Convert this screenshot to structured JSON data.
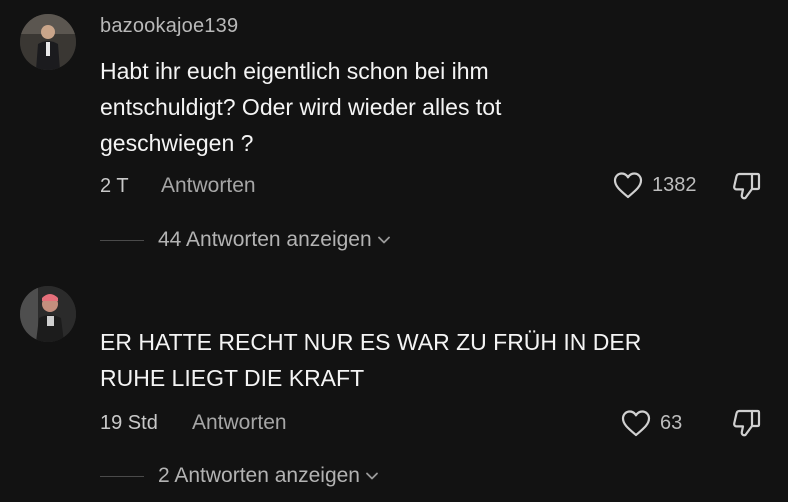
{
  "comments": [
    {
      "username": "bazookajoe139",
      "text_lines": [
        "Habt ihr euch eigentlich schon bei ihm",
        "entschuldigt? Oder wird wieder alles tot",
        "geschwiegen ?"
      ],
      "time": "2 T",
      "reply_label": "Antworten",
      "likes": "1382",
      "view_replies": "44 Antworten anzeigen"
    },
    {
      "username": "",
      "text_lines": [
        "ER HATTE RECHT NUR ES WAR ZU FRÜH IN DER",
        "RUHE LIEGT DIE KRAFT"
      ],
      "time": "19 Std",
      "reply_label": "Antworten",
      "likes": "63",
      "view_replies": "2 Antworten anzeigen"
    }
  ],
  "icons": {
    "like": "heart-outline-icon",
    "dislike": "thumbs-down-icon",
    "expand": "chevron-down-icon"
  },
  "colors": {
    "background": "#121212",
    "text": "#f4f4f4",
    "muted": "#a6a6a6"
  }
}
